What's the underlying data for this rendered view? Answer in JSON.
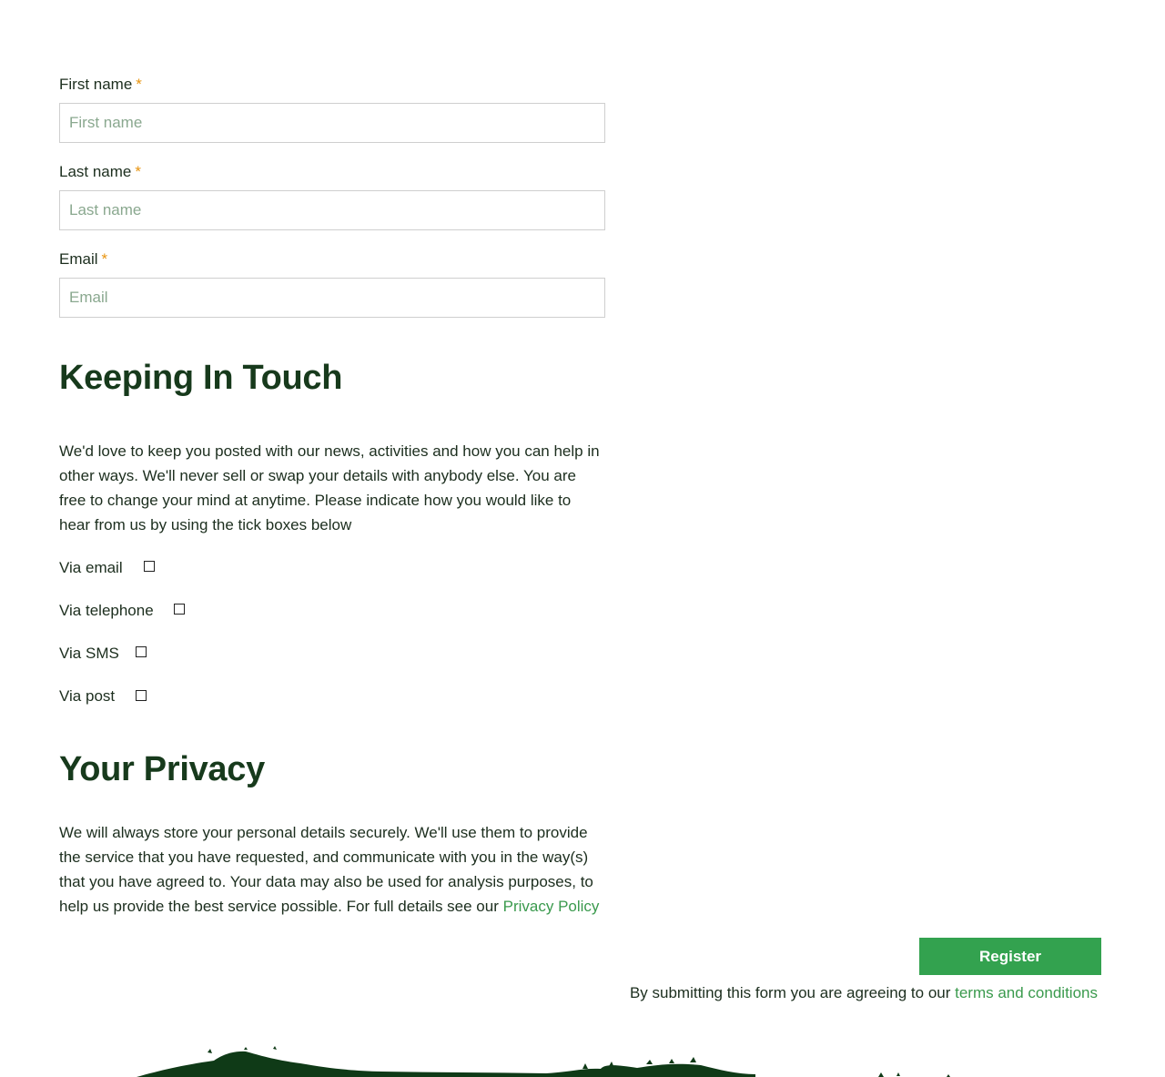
{
  "form": {
    "first_name": {
      "label": "First name",
      "required_mark": "*",
      "placeholder": "First name",
      "value": ""
    },
    "last_name": {
      "label": "Last name",
      "required_mark": "*",
      "placeholder": "Last name",
      "value": ""
    },
    "email": {
      "label": "Email",
      "required_mark": "*",
      "placeholder": "Email",
      "value": ""
    }
  },
  "keeping_in_touch": {
    "heading": "Keeping In Touch",
    "body": "We'd love to keep you posted with our news, activities and how you can help in other ways. We'll never sell or swap your details with anybody else. You are free to change your mind at anytime. Please indicate how you would like to hear from us by using the tick boxes below",
    "options": [
      {
        "label": "Via email",
        "checked": false
      },
      {
        "label": "Via telephone",
        "checked": false
      },
      {
        "label": "Via SMS",
        "checked": false
      },
      {
        "label": "Via post",
        "checked": false
      }
    ]
  },
  "privacy": {
    "heading": "Your Privacy",
    "body": "We will always store your personal details securely. We'll use them to provide the service that you have requested, and communicate with you in the way(s) that you have agreed to. Your data may also be used for analysis purposes, to help us provide the best service possible. For full details see our",
    "link_text": "Privacy Policy"
  },
  "submit": {
    "button_label": "Register",
    "terms_prefix": "By submitting this form you are agreeing to our",
    "terms_link": "terms and conditions"
  },
  "colors": {
    "heading": "#173a1c",
    "accent": "#33a24f",
    "link": "#3a9a4d",
    "required": "#e8940f",
    "footer_art": "#0f3a17"
  }
}
